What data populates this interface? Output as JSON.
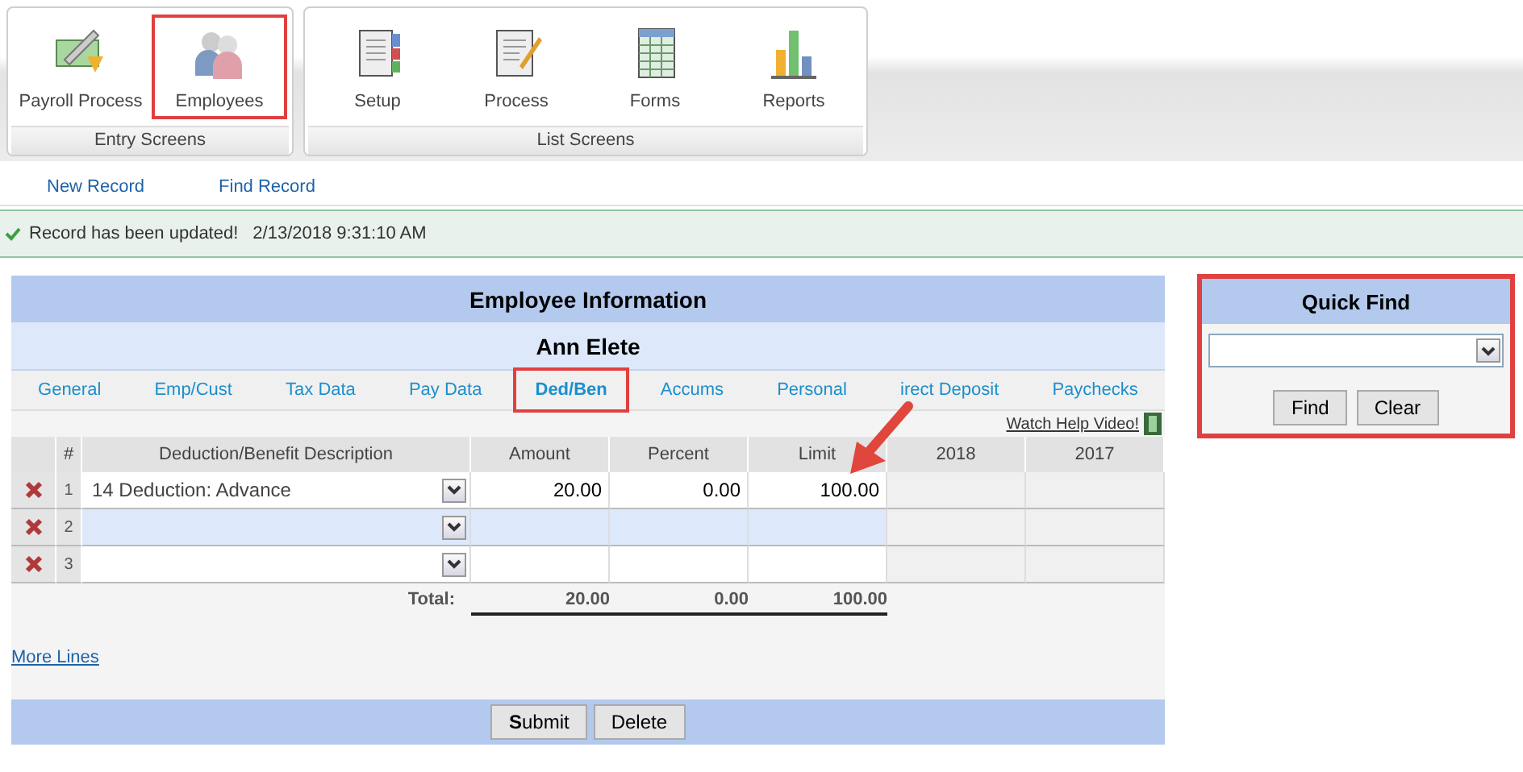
{
  "ribbon": {
    "groups": [
      {
        "label": "Entry Screens",
        "buttons": [
          {
            "label": "Payroll Process",
            "kind": "payroll",
            "highlighted": false
          },
          {
            "label": "Employees",
            "kind": "people",
            "highlighted": true
          }
        ]
      },
      {
        "label": "List Screens",
        "buttons": [
          {
            "label": "Setup",
            "kind": "binder",
            "highlighted": false
          },
          {
            "label": "Process",
            "kind": "notepad",
            "highlighted": false
          },
          {
            "label": "Forms",
            "kind": "sheet",
            "highlighted": false
          },
          {
            "label": "Reports",
            "kind": "chart",
            "highlighted": false
          }
        ]
      }
    ]
  },
  "actions": [
    "New Record",
    "Find Record"
  ],
  "status": {
    "message": "Record has been updated!",
    "timestamp": "2/13/2018 9:31:10 AM"
  },
  "panel": {
    "title": "Employee Information",
    "employee": "Ann Elete",
    "tabs": [
      {
        "label": "General",
        "selected": false,
        "highlighted": false
      },
      {
        "label": "Emp/Cust",
        "selected": false,
        "highlighted": false
      },
      {
        "label": "Tax Data",
        "selected": false,
        "highlighted": false
      },
      {
        "label": "Pay Data",
        "selected": false,
        "highlighted": false
      },
      {
        "label": "Ded/Ben",
        "selected": true,
        "highlighted": true
      },
      {
        "label": "Accums",
        "selected": false,
        "highlighted": false
      },
      {
        "label": "Personal",
        "selected": false,
        "highlighted": false
      },
      {
        "label": "irect Deposit",
        "selected": false,
        "highlighted": false
      },
      {
        "label": "Paychecks",
        "selected": false,
        "highlighted": false
      }
    ],
    "help_link": "Watch Help Video!",
    "columns": [
      "#",
      "Deduction/Benefit Description",
      "Amount",
      "Percent",
      "Limit",
      "2018",
      "2017"
    ],
    "rows": [
      {
        "number": "1",
        "description": "14 Deduction: Advance",
        "amount": "20.00",
        "percent": "0.00",
        "limit": "100.00",
        "selected": false
      },
      {
        "number": "2",
        "description": "",
        "amount": "",
        "percent": "",
        "limit": "",
        "selected": true
      },
      {
        "number": "3",
        "description": "",
        "amount": "",
        "percent": "",
        "limit": "",
        "selected": false
      }
    ],
    "totals": {
      "label": "Total:",
      "amount": "20.00",
      "percent": "0.00",
      "limit": "100.00"
    },
    "more_lines": "More Lines",
    "buttons": [
      "**S**ubmit",
      "Delete"
    ]
  },
  "quick_find": {
    "title": "Quick Find",
    "highlighted": true,
    "buttons": [
      "Find",
      "Clear"
    ]
  },
  "annotation": {
    "kind": "arrow"
  }
}
